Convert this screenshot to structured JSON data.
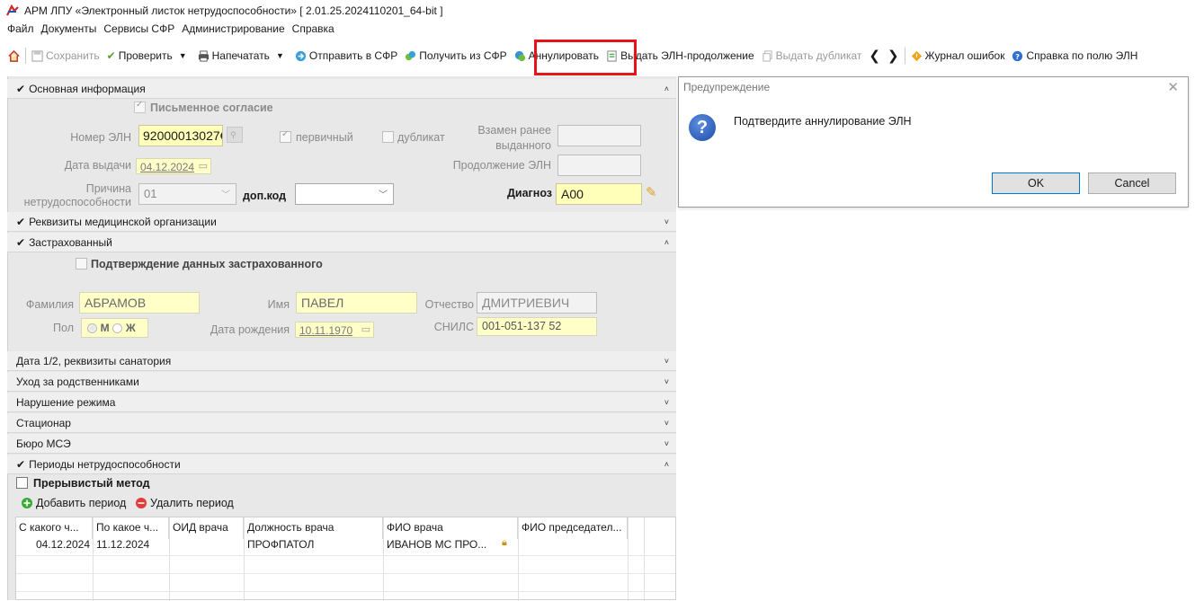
{
  "window": {
    "title": "АРМ ЛПУ «Электронный листок нетрудоспособности»  [ 2.01.25.2024110201_64-bit ]"
  },
  "menu": [
    "Файл",
    "Документы",
    "Сервисы СФР",
    "Администрирование",
    "Справка"
  ],
  "toolbar": {
    "save": "Сохранить",
    "check": "Проверить",
    "print": "Напечатать",
    "send": "Отправить в СФР",
    "receive": "Получить из СФР",
    "annul": "Аннулировать",
    "continue": "Выдать ЭЛН-продолжение",
    "duplicate": "Выдать дубликат",
    "errors": "Журнал ошибок",
    "help": "Справка по полю ЭЛН"
  },
  "main_info": {
    "header": "Основная информация",
    "written_consent": "Письменное согласие",
    "eln_number_label": "Номер ЭЛН",
    "eln_number": "92000013027€",
    "primary_label": "первичный",
    "duplicate_label": "дубликат",
    "replaced_label_1": "Взамен ранее",
    "replaced_label_2": "выданного",
    "issue_date_label": "Дата выдачи",
    "issue_date": "04.12.2024",
    "continuation_label": "Продолжение ЭЛН",
    "reason_label_1": "Причина",
    "reason_label_2": "нетрудоспособности",
    "reason_code": "01",
    "extra_code_label": "доп.код",
    "diagnosis_label": "Диагноз",
    "diagnosis": "A00"
  },
  "med_org": {
    "header": "Реквизиты медицинской организации"
  },
  "insured": {
    "header": "Застрахованный",
    "confirm_label": "Подтверждение данных застрахованного",
    "surname_label": "Фамилия",
    "surname": "АБРАМОВ",
    "name_label": "Имя",
    "name": "ПАВЕЛ",
    "patronymic_label": "Отчество",
    "patronymic": "ДМИТРИЕВИЧ",
    "sex_label": "Пол",
    "sex_m": "М",
    "sex_f": "Ж",
    "birth_label": "Дата рождения",
    "birth_date": "10.11.1970",
    "snils_label": "СНИЛС",
    "snils": "001-051-137 52"
  },
  "collapsed_sections": [
    "Дата 1/2, реквизиты санатория",
    "Уход за родственниками",
    "Нарушение режима",
    "Стационар",
    "Бюро МСЭ"
  ],
  "periods": {
    "header": "Периоды нетрудоспособности",
    "intermittent": "Прерывистый метод",
    "add": "Добавить период",
    "remove": "Удалить период",
    "columns": [
      "С какого ч...",
      "По какое ч...",
      "ОИД врача",
      "Должность врача",
      "ФИО врача",
      "ФИО председател..."
    ],
    "rows": [
      [
        "04.12.2024",
        "11.12.2024",
        "",
        "ПРОФПАТОЛ",
        "ИВАНОВ МС ПРО...",
        ""
      ]
    ]
  },
  "dialog": {
    "title": "Предупреждение",
    "message": "Подтвердите аннулирование ЭЛН",
    "ok": "OK",
    "cancel": "Cancel"
  },
  "colors": {
    "highlight": "#e5141b",
    "required_field": "#ffffb9",
    "panel": "#e8e8e8"
  }
}
